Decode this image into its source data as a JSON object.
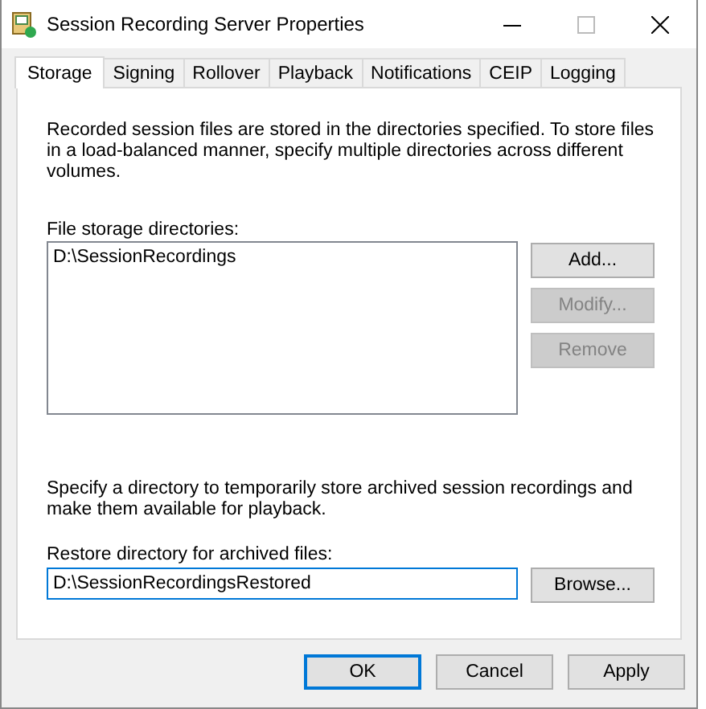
{
  "window": {
    "title": "Session Recording Server Properties"
  },
  "tabs": [
    {
      "label": "Storage",
      "selected": true
    },
    {
      "label": "Signing",
      "selected": false
    },
    {
      "label": "Rollover",
      "selected": false
    },
    {
      "label": "Playback",
      "selected": false
    },
    {
      "label": "Notifications",
      "selected": false
    },
    {
      "label": "CEIP",
      "selected": false
    },
    {
      "label": "Logging",
      "selected": false
    }
  ],
  "storage": {
    "description": "Recorded session files are stored in the directories specified. To store files in a load-balanced manner, specify multiple directories across different volumes.",
    "list_label": "File storage directories:",
    "directories": [
      "D:\\SessionRecordings"
    ],
    "list_buttons": [
      {
        "label": "Add...",
        "disabled": false
      },
      {
        "label": "Modify...",
        "disabled": true
      },
      {
        "label": "Remove",
        "disabled": true
      }
    ],
    "restore_description": "Specify a directory to temporarily store archived session recordings and make them available for playback.",
    "restore_label": "Restore directory for archived files:",
    "restore_value": "D:\\SessionRecordingsRestored",
    "restore_focused": true,
    "browse_button": "Browse..."
  },
  "buttons": [
    {
      "label": "OK",
      "default": true
    },
    {
      "label": "Cancel",
      "default": false
    },
    {
      "label": "Apply",
      "default": false
    }
  ]
}
